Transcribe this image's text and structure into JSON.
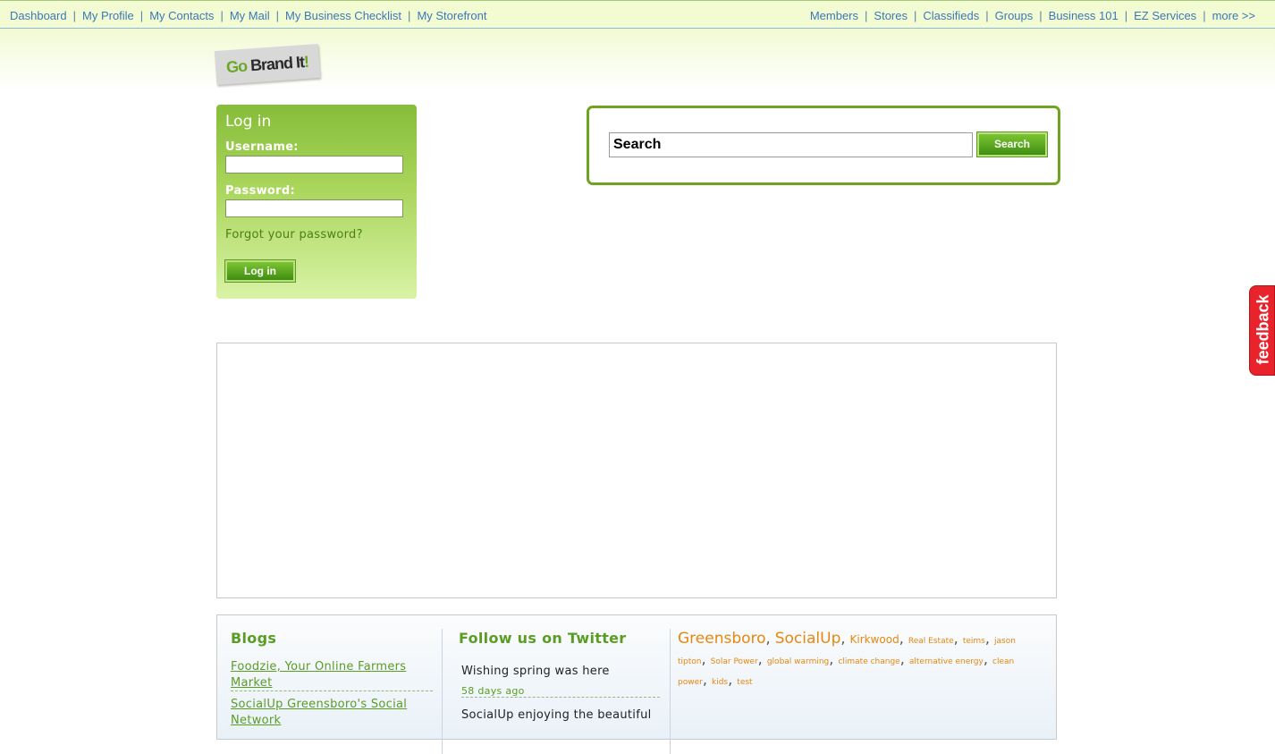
{
  "topnav": {
    "left": [
      "Dashboard",
      "My Profile",
      "My Contacts",
      "My Mail",
      "My Business Checklist",
      "My Storefront"
    ],
    "right": [
      "Members",
      "Stores",
      "Classifieds",
      "Groups",
      "Business 101",
      "EZ Services",
      "more >>"
    ],
    "separator": "|"
  },
  "logo": {
    "go": "Go",
    "brand": "Brand It",
    "bang": "!"
  },
  "login": {
    "title": "Log in",
    "username_label": "Username:",
    "password_label": "Password:",
    "forgot": "Forgot your password?",
    "button": "Log in"
  },
  "search": {
    "value": "Search",
    "button": "Search"
  },
  "feedback": {
    "label": "feedback"
  },
  "footer": {
    "blogs": {
      "title": "Blogs",
      "items": [
        "Foodzie, Your Online Farmers Market",
        "SocialUp Greensboro's Social Network"
      ]
    },
    "twitter": {
      "title": "Follow us on Twitter",
      "tweets": [
        {
          "text": "Wishing spring was here",
          "time": "58 days ago"
        },
        {
          "text": "SocialUp enjoying the beautiful",
          "time": ""
        }
      ]
    },
    "tags": [
      "Greensboro",
      "SocialUp",
      "Kirkwood",
      "Real Estate",
      "teims",
      "jason tipton",
      "Solar Power",
      "global warming",
      "climate change",
      "alternative energy",
      "clean power",
      "kids",
      "test"
    ]
  },
  "colors": {
    "accent_green": "#6ea421",
    "link_blue": "#3a78b8",
    "tag_orange": "#e8870f",
    "feedback_red": "#e8232b"
  }
}
